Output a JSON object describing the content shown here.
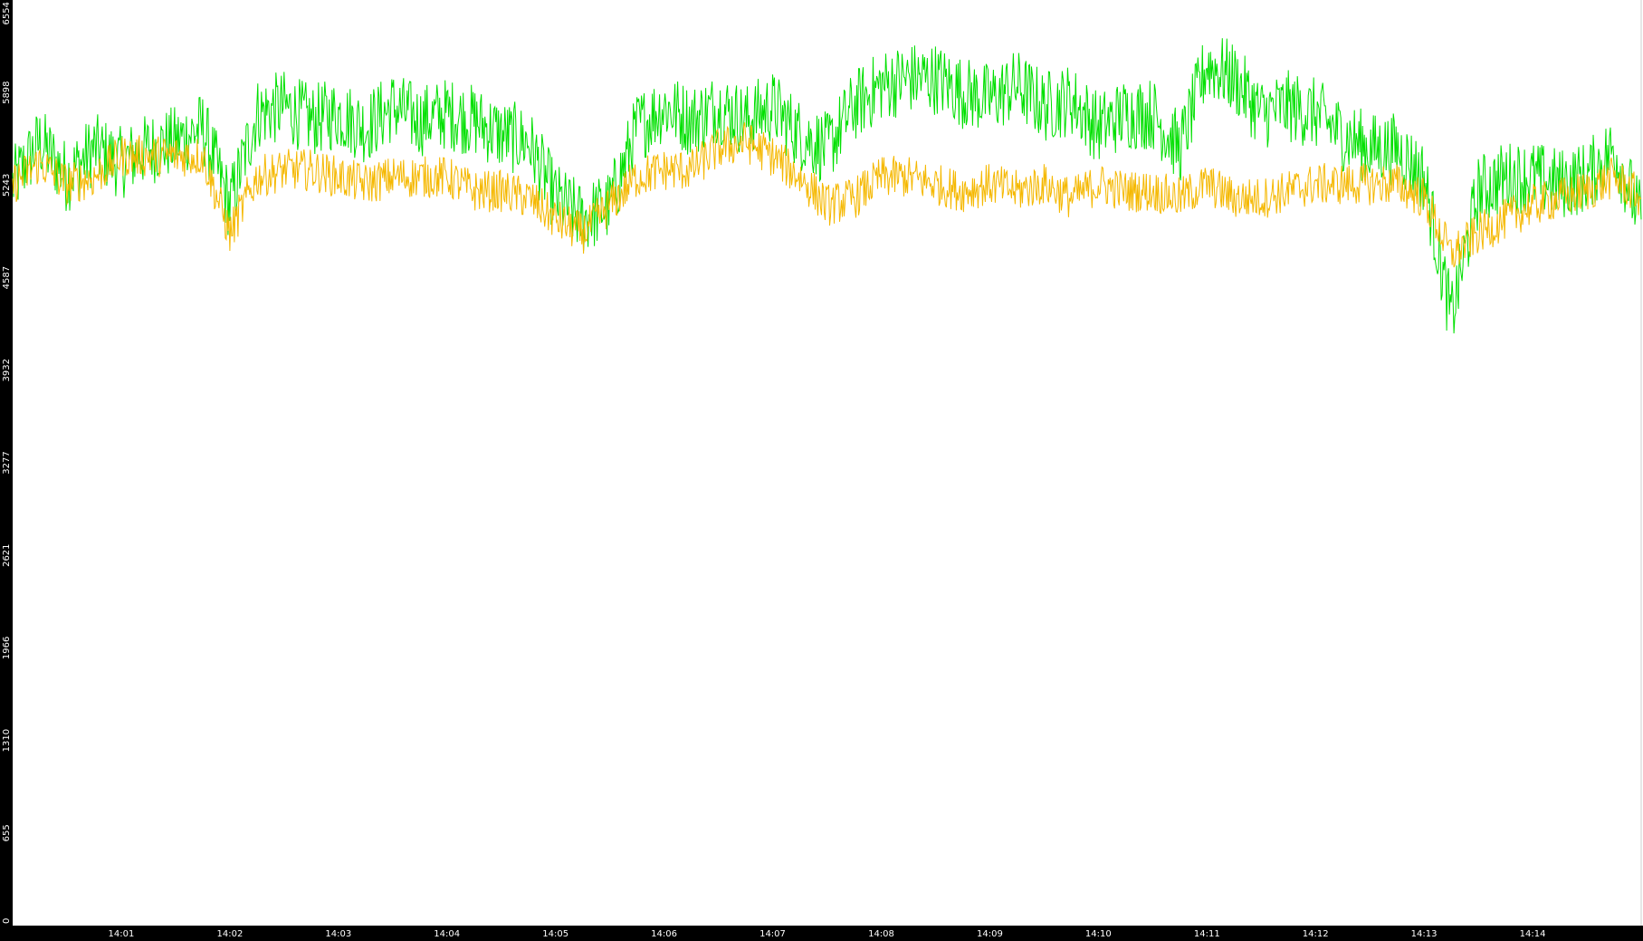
{
  "chart_data": {
    "type": "line",
    "yticks": [
      "0",
      "655",
      "1310",
      "1966",
      "2621",
      "3277",
      "3932",
      "4587",
      "5243",
      "5898",
      "6554"
    ],
    "ylim": [
      0,
      6554
    ],
    "xticks": [
      "14:01",
      "14:02",
      "14:03",
      "14:04",
      "14:05",
      "14:06",
      "14:07",
      "14:08",
      "14:09",
      "14:10",
      "14:11",
      "14:12",
      "14:13",
      "14:14"
    ],
    "x_tick_minutes": [
      1,
      2,
      3,
      4,
      5,
      6,
      7,
      8,
      9,
      10,
      11,
      12,
      13,
      14
    ],
    "xlim_minutes": [
      0,
      15
    ],
    "grid": false,
    "legend": "none",
    "series": [
      {
        "color": "#00e000",
        "x_minutes": [
          0.0,
          0.25,
          0.5,
          0.75,
          1.0,
          1.25,
          1.5,
          1.75,
          2.0,
          2.25,
          2.5,
          2.75,
          3.0,
          3.25,
          3.5,
          3.75,
          4.0,
          4.25,
          4.5,
          4.75,
          5.0,
          5.25,
          5.5,
          5.75,
          6.0,
          6.25,
          6.5,
          6.75,
          7.0,
          7.25,
          7.5,
          7.75,
          8.0,
          8.25,
          8.5,
          8.75,
          9.0,
          9.25,
          9.5,
          9.75,
          10.0,
          10.25,
          10.5,
          10.75,
          11.0,
          11.25,
          11.5,
          11.75,
          12.0,
          12.25,
          12.5,
          12.75,
          13.0,
          13.25,
          13.5,
          13.75,
          14.0,
          14.25,
          14.5,
          14.75,
          15.0
        ],
        "values": [
          5250,
          5550,
          5300,
          5500,
          5400,
          5500,
          5550,
          5650,
          5100,
          5750,
          5800,
          5700,
          5750,
          5650,
          5800,
          5700,
          5750,
          5700,
          5600,
          5550,
          5150,
          5000,
          5100,
          5650,
          5800,
          5700,
          5800,
          5700,
          5800,
          5600,
          5500,
          5800,
          5950,
          6000,
          6000,
          5900,
          5850,
          5950,
          5800,
          5850,
          5650,
          5750,
          5750,
          5500,
          6100,
          6000,
          5750,
          5800,
          5750,
          5600,
          5500,
          5500,
          5300,
          4300,
          5200,
          5300,
          5300,
          5250,
          5300,
          5500,
          5000
        ]
      },
      {
        "color": "#f5b800",
        "x_minutes": [
          0.0,
          0.25,
          0.5,
          0.75,
          1.0,
          1.25,
          1.5,
          1.75,
          2.0,
          2.25,
          2.5,
          2.75,
          3.0,
          3.25,
          3.5,
          3.75,
          4.0,
          4.25,
          4.5,
          4.75,
          5.0,
          5.25,
          5.5,
          5.75,
          6.0,
          6.25,
          6.5,
          6.75,
          7.0,
          7.25,
          7.5,
          7.75,
          8.0,
          8.25,
          8.5,
          8.75,
          9.0,
          9.25,
          9.5,
          9.75,
          10.0,
          10.25,
          10.5,
          10.75,
          11.0,
          11.25,
          11.5,
          11.75,
          12.0,
          12.25,
          12.5,
          12.75,
          13.0,
          13.25,
          13.5,
          13.75,
          14.0,
          14.25,
          14.5,
          14.75,
          15.0
        ],
        "values": [
          5250,
          5400,
          5250,
          5300,
          5450,
          5450,
          5450,
          5450,
          4900,
          5300,
          5350,
          5350,
          5300,
          5250,
          5300,
          5300,
          5300,
          5200,
          5200,
          5150,
          5000,
          4900,
          5100,
          5300,
          5350,
          5350,
          5500,
          5550,
          5450,
          5300,
          5100,
          5150,
          5300,
          5300,
          5250,
          5200,
          5250,
          5200,
          5250,
          5150,
          5250,
          5200,
          5200,
          5150,
          5250,
          5150,
          5150,
          5200,
          5250,
          5250,
          5250,
          5250,
          5150,
          4750,
          4900,
          5000,
          5100,
          5150,
          5200,
          5300,
          5150
        ]
      }
    ]
  }
}
